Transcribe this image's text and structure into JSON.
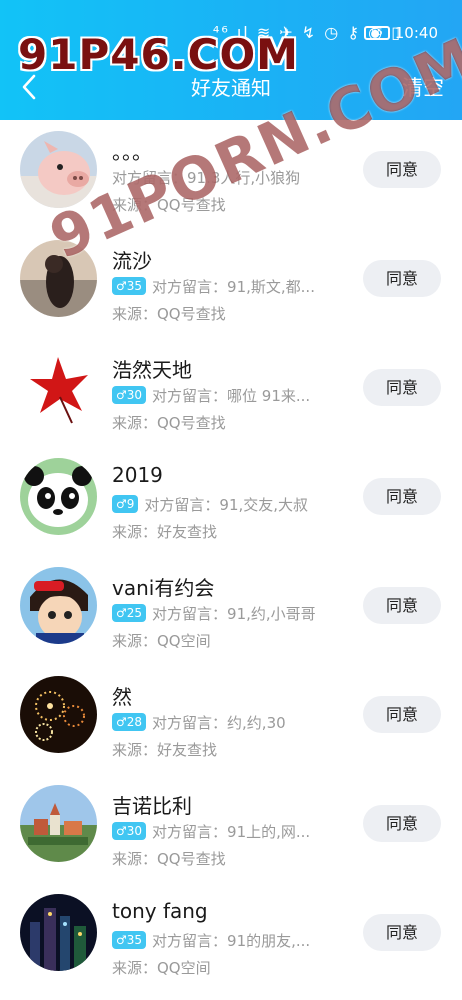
{
  "status_bar": {
    "icons": "⁴⁶.ıl ≋ ✈ ↯  ◷ ⚷ ◉ ▯",
    "battery": "55",
    "time": "10:40"
  },
  "header": {
    "title": "好友通知",
    "clear_label": "清空"
  },
  "watermarks": {
    "top": "91P46.COM",
    "diagonal": "91PORN.COM"
  },
  "requests": [
    {
      "name": "。。。",
      "badge": "",
      "message": "对方留言：91.3人行,小狼狗",
      "source": "来源：QQ号查找",
      "action": "同意",
      "avatar": "pig"
    },
    {
      "name": "流沙",
      "badge": "♂35",
      "message": "对方留言：91,斯文,都...",
      "source": "来源：QQ号查找",
      "action": "同意",
      "avatar": "sunset"
    },
    {
      "name": "浩然天地",
      "badge": "♂30",
      "message": "对方留言：哪位 91来...",
      "source": "来源：QQ号查找",
      "action": "同意",
      "avatar": "maple"
    },
    {
      "name": "2019",
      "badge": "♂9",
      "message": "对方留言：91,交友,大叔",
      "source": "来源：好友查找",
      "action": "同意",
      "avatar": "panda"
    },
    {
      "name": "vani有约会",
      "badge": "♂25",
      "message": "对方留言：91,约,小哥哥",
      "source": "来源：QQ空间",
      "action": "同意",
      "avatar": "anime"
    },
    {
      "name": "然",
      "badge": "♂28",
      "message": "对方留言：约,约,30",
      "source": "来源：好友查找",
      "action": "同意",
      "avatar": "fireworks"
    },
    {
      "name": "吉诺比利",
      "badge": "♂30",
      "message": "对方留言：91上的,网...",
      "source": "来源：QQ号查找",
      "action": "同意",
      "avatar": "town"
    },
    {
      "name": "tony fang",
      "badge": "♂35",
      "message": "对方留言：91的朋友,...",
      "source": "来源：QQ空间",
      "action": "同意",
      "avatar": "city"
    }
  ]
}
